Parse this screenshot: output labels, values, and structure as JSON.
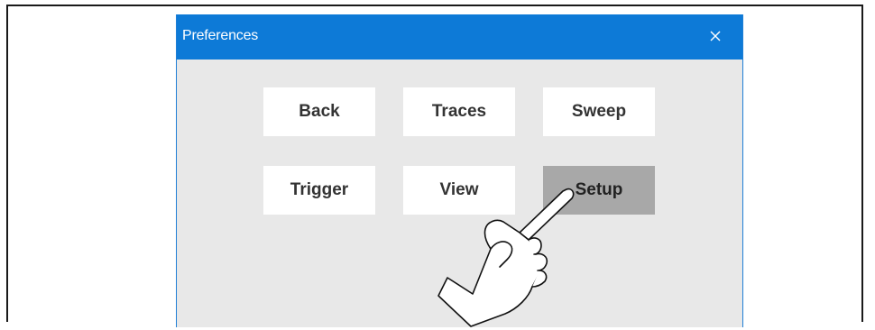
{
  "dialog": {
    "title": "Preferences",
    "close_glyph": "×",
    "title_bar_color": "#0d7ad7",
    "background_color": "#e8e8e8"
  },
  "buttons": [
    {
      "label": "Back",
      "state": "normal"
    },
    {
      "label": "Traces",
      "state": "normal"
    },
    {
      "label": "Sweep",
      "state": "normal"
    },
    {
      "label": "Trigger",
      "state": "normal"
    },
    {
      "label": "View",
      "state": "normal"
    },
    {
      "label": "Setup",
      "state": "pressed"
    }
  ],
  "overlay": {
    "icon": "pointing-hand-icon",
    "target": "Setup"
  }
}
